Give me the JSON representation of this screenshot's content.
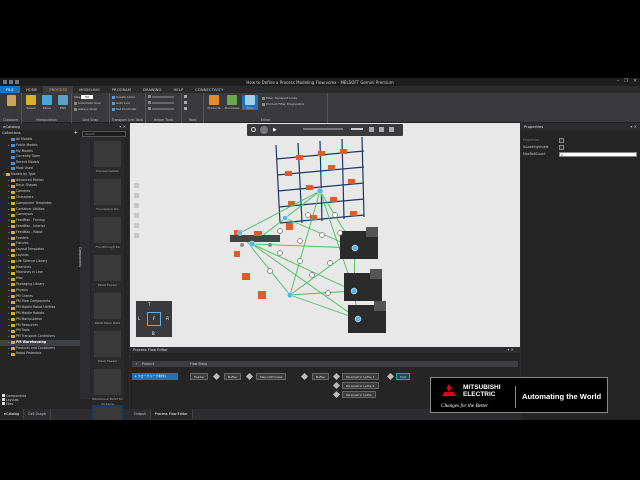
{
  "window": {
    "title": "How to Define a Process Modeling Flow.vcmx - MELSOFT Gemini Premium",
    "controls": [
      "–",
      "❐",
      "✕"
    ]
  },
  "menu": [
    "FILE",
    "HOME",
    "PROCESS",
    "MODELING",
    "PROGRAM",
    "DRAWING",
    "HELP",
    "CONNECTIVITY"
  ],
  "ribbon": {
    "groups": [
      "Clipboard",
      "Manipulation",
      "Grid Snap",
      "Transport Link Tools",
      "Helper Tools",
      "Tools",
      "Editor"
    ],
    "snap": {
      "size": "50",
      "auto_size": "Automatic Size",
      "always_snap": "Always Snap"
    },
    "transport": [
      "Create Links",
      "Auto Link",
      "Set Controller"
    ],
    "buttons": {
      "select": "Select",
      "move": "Move",
      "pnp": "PNP",
      "products": "Products",
      "processes": "Processes",
      "flow": "Flow"
    },
    "editor": [
      "Filter Transport Links",
      "Product Filter Diagnostics"
    ]
  },
  "catalog": {
    "title": "eCatalog",
    "collections_title": "Collections",
    "search_placeholder": "Search",
    "items": [
      {
        "label": "All Models",
        "indent": 1,
        "arrow": ""
      },
      {
        "label": "Public Models",
        "indent": 1,
        "arrow": "▸"
      },
      {
        "label": "My Models",
        "indent": 1,
        "arrow": ""
      },
      {
        "label": "Currently Open",
        "indent": 1,
        "arrow": ""
      },
      {
        "label": "Recent Models",
        "indent": 1,
        "arrow": ""
      },
      {
        "label": "Most Used",
        "indent": 1,
        "arrow": ""
      },
      {
        "label": "Models by Type",
        "indent": 0,
        "arrow": "▾"
      },
      {
        "label": "Advanced Motion",
        "indent": 1,
        "arrow": "▸"
      },
      {
        "label": "Basic Shapes",
        "indent": 1,
        "arrow": "▸"
      },
      {
        "label": "Cameras",
        "indent": 1,
        "arrow": "▸"
      },
      {
        "label": "Characters",
        "indent": 1,
        "arrow": "▸"
      },
      {
        "label": "Component Templates",
        "indent": 1,
        "arrow": "▸"
      },
      {
        "label": "Container Utilities",
        "indent": 1,
        "arrow": "▸"
      },
      {
        "label": "Conveyors",
        "indent": 1,
        "arrow": "▸"
      },
      {
        "label": "FeedMax - Fanling",
        "indent": 1,
        "arrow": "▸"
      },
      {
        "label": "FeedMax - Interior",
        "indent": 1,
        "arrow": "▸"
      },
      {
        "label": "FeedMax - Robot",
        "indent": 1,
        "arrow": "▸"
      },
      {
        "label": "Feeders",
        "indent": 1,
        "arrow": "▸"
      },
      {
        "label": "Fixtures",
        "indent": 1,
        "arrow": "▸"
      },
      {
        "label": "Layout Templates",
        "indent": 1,
        "arrow": "▸"
      },
      {
        "label": "Layouts",
        "indent": 1,
        "arrow": "▸"
      },
      {
        "label": "Life Science Library",
        "indent": 1,
        "arrow": "▸"
      },
      {
        "label": "Machines",
        "indent": 1,
        "arrow": "▸"
      },
      {
        "label": "Machines in Line",
        "indent": 1,
        "arrow": "▸"
      },
      {
        "label": "Misc",
        "indent": 1,
        "arrow": "▸"
      },
      {
        "label": "Packaging Library",
        "indent": 1,
        "arrow": "▸"
      },
      {
        "label": "Physics",
        "indent": 1,
        "arrow": "▸"
      },
      {
        "label": "PM Cranes",
        "indent": 1,
        "arrow": "▸"
      },
      {
        "label": "PM Flow Components",
        "indent": 1,
        "arrow": "▸"
      },
      {
        "label": "PM Mobile Robot Utilities",
        "indent": 1,
        "arrow": "▸"
      },
      {
        "label": "PM Mobile Robots",
        "indent": 1,
        "arrow": "▸"
      },
      {
        "label": "PM Manipulation",
        "indent": 1,
        "arrow": "▸"
      },
      {
        "label": "PM Resources",
        "indent": 1,
        "arrow": "▸"
      },
      {
        "label": "PM Tools",
        "indent": 1,
        "arrow": "▸"
      },
      {
        "label": "PM Transport Controllers",
        "indent": 1,
        "arrow": "▸"
      },
      {
        "label": "PM Warehousing",
        "indent": 1,
        "arrow": "▸",
        "bold": true
      },
      {
        "label": "Products and Containers",
        "indent": 1,
        "arrow": "▸"
      },
      {
        "label": "Robot Pedestals",
        "indent": 1,
        "arrow": "▸"
      }
    ],
    "footer": [
      "Components",
      "Layouts",
      "Files"
    ],
    "bottom_tabs": [
      "eCatalog",
      "Cell Graph"
    ],
    "side_tab": "Components",
    "items_count": "30 Items",
    "thumbs": [
      "Process Gether",
      "Floorspace Sto",
      "Floorthrough Ra",
      "Pallet Feeder",
      "Pallet Stack Rack",
      "Stack Feeder",
      "Warehouse Pallet Shelf",
      "Warehouse She"
    ]
  },
  "properties": {
    "title": "Properties",
    "rows": [
      {
        "name": "Properties",
        "type": "check"
      },
      {
        "name": "IsLoadingVisible",
        "type": "check"
      },
      {
        "name": "MaxBaltCount",
        "type": "num",
        "value": "1"
      }
    ]
  },
  "process_flow_editor": {
    "title": "Process Flow Editor",
    "columns": [
      "Product",
      "Flow Steps"
    ],
    "row_label": "フローグループ条件1",
    "nodes": [
      "Feeder",
      "Buffer",
      "ManualProcess",
      "Buffer",
      "Parametric Lathe 1",
      "Parametric Lathe 2",
      "Parametric Lathe",
      "Sink"
    ]
  },
  "bottom_tabs": [
    "Output",
    "Process Flow Editor"
  ],
  "brand": {
    "line1": "MITSUBISHI",
    "line2": "ELECTRIC",
    "tagline": "Changes for the Better",
    "slogan": "Automating the World"
  },
  "viewcube": [
    "T",
    "L",
    "R",
    "B",
    "F"
  ]
}
